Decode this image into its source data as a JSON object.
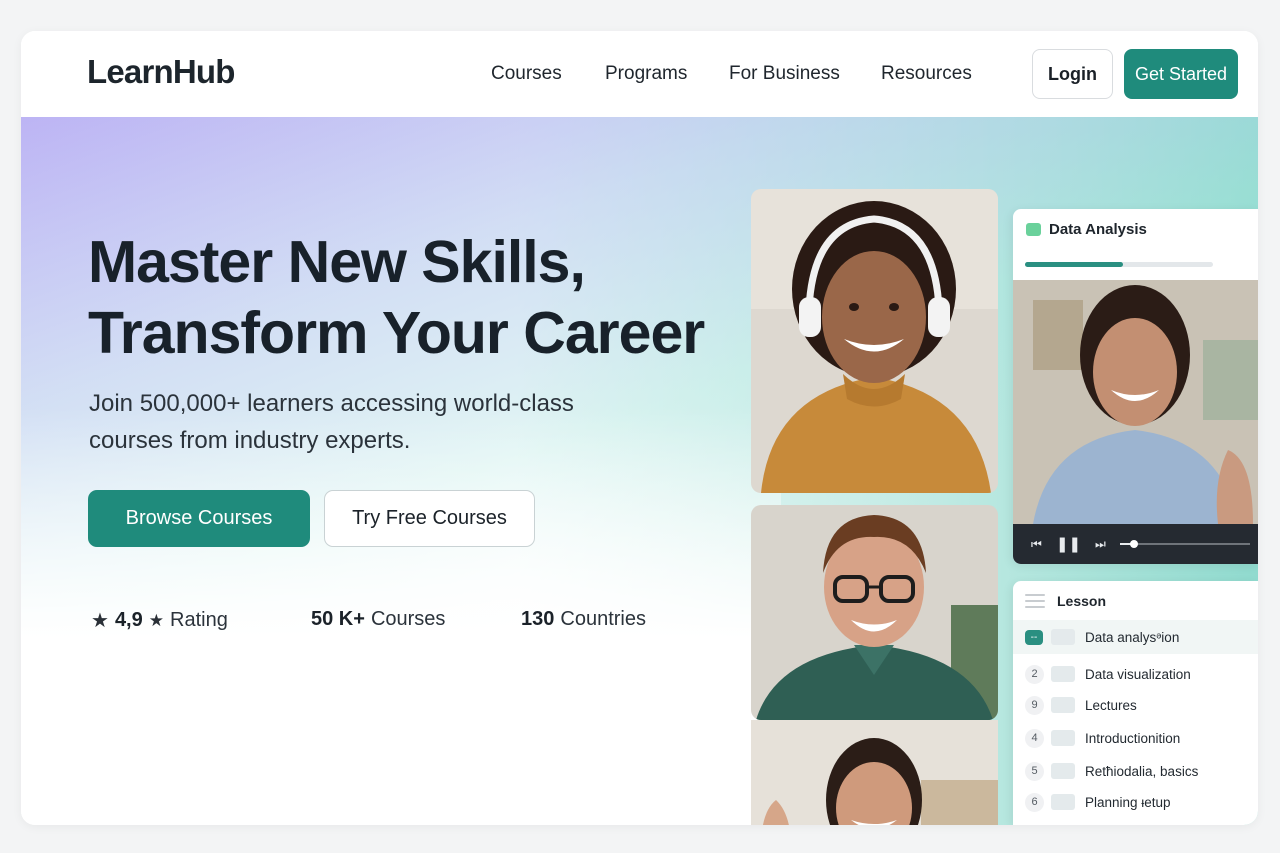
{
  "nav": {
    "logo": "LearnHub",
    "links": [
      "Courses",
      "Programs",
      "For Business",
      "Resources"
    ],
    "login_label": "Login",
    "get_started_label": "Get Started"
  },
  "hero": {
    "headline_line1": "Master New Skills,",
    "headline_line2": "Transform Your Career",
    "subtitle_line1": "Join 500,000+ learners accessing world-class",
    "subtitle_line2": "courses from industry experts.",
    "browse_label": "Browse Courses",
    "free_label": "Try Free Courses",
    "stats": [
      {
        "value": "4,9",
        "label": "Rating"
      },
      {
        "value": "50 K+",
        "label": "Courses"
      },
      {
        "value": "130",
        "label": "Countries"
      }
    ]
  },
  "player": {
    "title": "Data Analysis",
    "progress_fraction": 0.52,
    "seek_fraction": 0.08
  },
  "lesson": {
    "title": "Lesson",
    "items": [
      {
        "num": "--",
        "label": "Data analysᵊion",
        "active": true
      },
      {
        "num": "2",
        "label": "Data visualization",
        "active": false
      },
      {
        "num": "9",
        "label": "Lectures",
        "active": false
      },
      {
        "num": "4",
        "label": "Introductionition",
        "active": false
      },
      {
        "num": "5",
        "label": "Retħiodalia, basics",
        "active": false
      },
      {
        "num": "6",
        "label": "Planning ᵼetup",
        "active": false
      }
    ]
  },
  "colors": {
    "brand_teal": "#1f8b7c",
    "accent_green": "#6ad19b",
    "gradient_lavender": "#b9b0f4",
    "gradient_mint": "#7dd4c6"
  }
}
